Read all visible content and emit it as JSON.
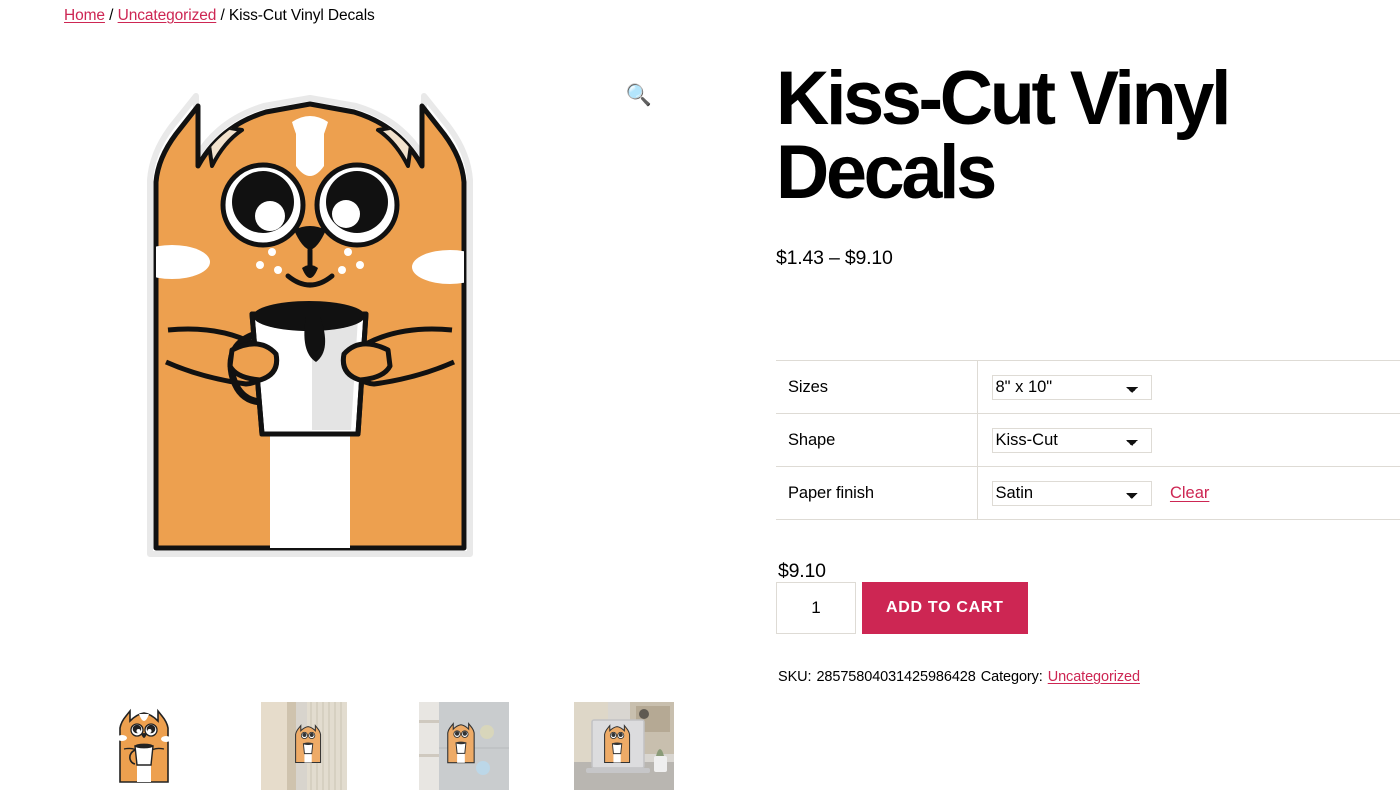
{
  "breadcrumb": {
    "home": "Home",
    "category": "Uncategorized",
    "current": "Kiss-Cut Vinyl Decals",
    "separator": "/"
  },
  "gallery": {
    "zoom_icon": "magnifier-icon",
    "zoom_glyph": "🔍",
    "main_alt": "Orange cat sticker holding a white coffee mug",
    "thumbnails": [
      {
        "alt": "Kiss-cut vinyl decal of orange cat holding mug on white background",
        "scene": "plain"
      },
      {
        "alt": "Decal applied to a wooden door frame",
        "scene": "door"
      },
      {
        "alt": "Decal applied to a refrigerator door",
        "scene": "fridge"
      },
      {
        "alt": "Decal applied to a laptop lid on a desk",
        "scene": "laptop"
      }
    ]
  },
  "product": {
    "title": "Kiss-Cut Vinyl Decals",
    "price_range": "$1.43 – $9.10",
    "selected_price": "$9.10"
  },
  "variations": {
    "rows": [
      {
        "label": "Sizes",
        "selected": "8\" x 10\"",
        "options": [
          "8\" x 10\""
        ],
        "has_clear": false
      },
      {
        "label": "Shape",
        "selected": "Kiss-Cut",
        "options": [
          "Kiss-Cut"
        ],
        "has_clear": false
      },
      {
        "label": "Paper finish",
        "selected": "Satin",
        "options": [
          "Satin"
        ],
        "has_clear": true
      }
    ],
    "clear_label": "Clear"
  },
  "cart": {
    "quantity": "1",
    "add_to_cart_label": "ADD TO CART"
  },
  "meta": {
    "sku_label": "SKU:",
    "sku_value": "28575804031425986428",
    "category_label": "Category:",
    "category_value": "Uncategorized"
  },
  "colors": {
    "accent": "#cd2653",
    "border": "#dedbd5",
    "cat_orange": "#eda04f",
    "text": "#000000"
  }
}
